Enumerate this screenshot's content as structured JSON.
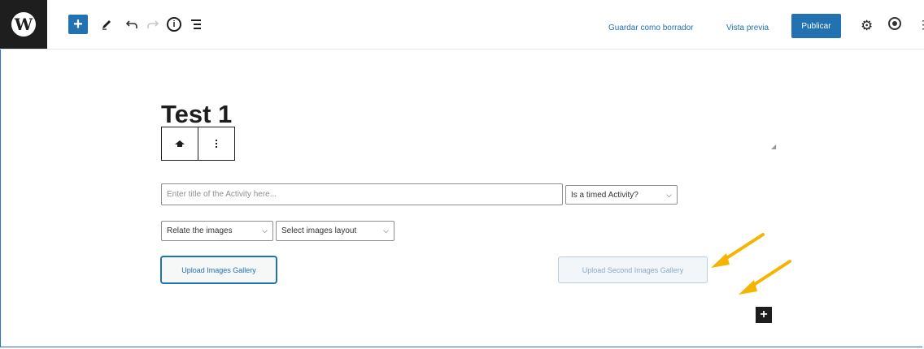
{
  "toolbar": {
    "logo_letter": "W",
    "add_label": "+",
    "draft_label": "Guardar como borrador",
    "preview_label": "Vista previa",
    "publish_label": "Publicar",
    "more_label": "⋮",
    "accent_color": "#2271b1"
  },
  "editor": {
    "post_title": "Test 1",
    "activity_title_placeholder": "Enter title of the Activity here...",
    "timed_select_value": "Is a timed Activity?",
    "relate_select_value": "Relate the images",
    "layout_select_value": "Select images layout",
    "upload_first_label": "Upload Images Gallery",
    "upload_second_label": "Upload Second Images Gallery",
    "inserter_label": "+"
  },
  "annotation": {
    "arrow_color": "#f5b400"
  }
}
